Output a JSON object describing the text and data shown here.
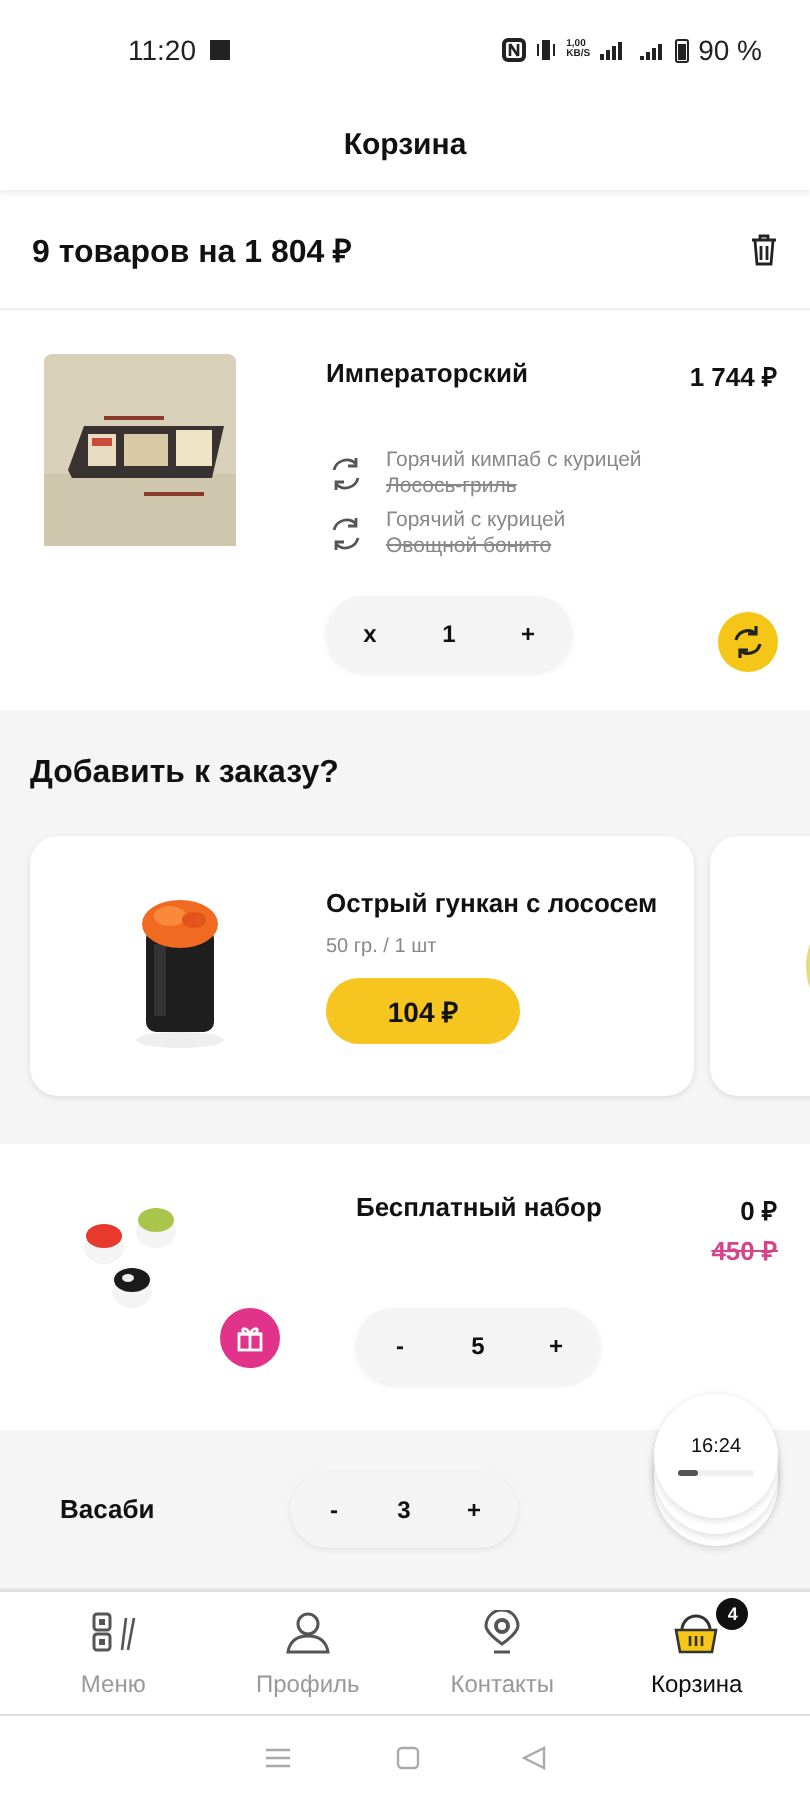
{
  "status_bar": {
    "time": "11:20",
    "net_speed": "1,00",
    "net_unit": "KB/S",
    "battery": "90 %"
  },
  "header": {
    "title": "Корзина"
  },
  "summary": {
    "text": "9 товаров на 1 804 ₽"
  },
  "cart_item": {
    "name": "Императорский",
    "price": "1 744 ₽",
    "replacements": [
      {
        "name": "Горячий кимпаб с курицей",
        "replaced": "Лосось-гриль"
      },
      {
        "name": "Горячий с курицей",
        "replaced": "Овощной бонито"
      }
    ],
    "decrease": "x",
    "quantity": "1",
    "increase": "+"
  },
  "addons": {
    "title": "Добавить к заказу?",
    "cards": [
      {
        "kind": "product",
        "name": "Острый гункан с лососем",
        "weight": "50 гр. / 1 шт",
        "price": "104 ₽"
      },
      {
        "kind": "partial"
      }
    ]
  },
  "free_set": {
    "name": "Бесплатный набор",
    "price": "0 ₽",
    "old_price": "450 ₽",
    "decrease": "-",
    "quantity": "5",
    "increase": "+"
  },
  "extra": {
    "name": "Васаби",
    "decrease": "-",
    "quantity": "3",
    "increase": "+"
  },
  "timer": {
    "time": "16:24",
    "level": 0.25
  },
  "tab_bar": [
    {
      "label": "Меню",
      "selected": false
    },
    {
      "label": "Профиль",
      "selected": false
    },
    {
      "label": "Контакты",
      "selected": false
    },
    {
      "label": "Корзина",
      "selected": true,
      "badge": "4"
    }
  ]
}
